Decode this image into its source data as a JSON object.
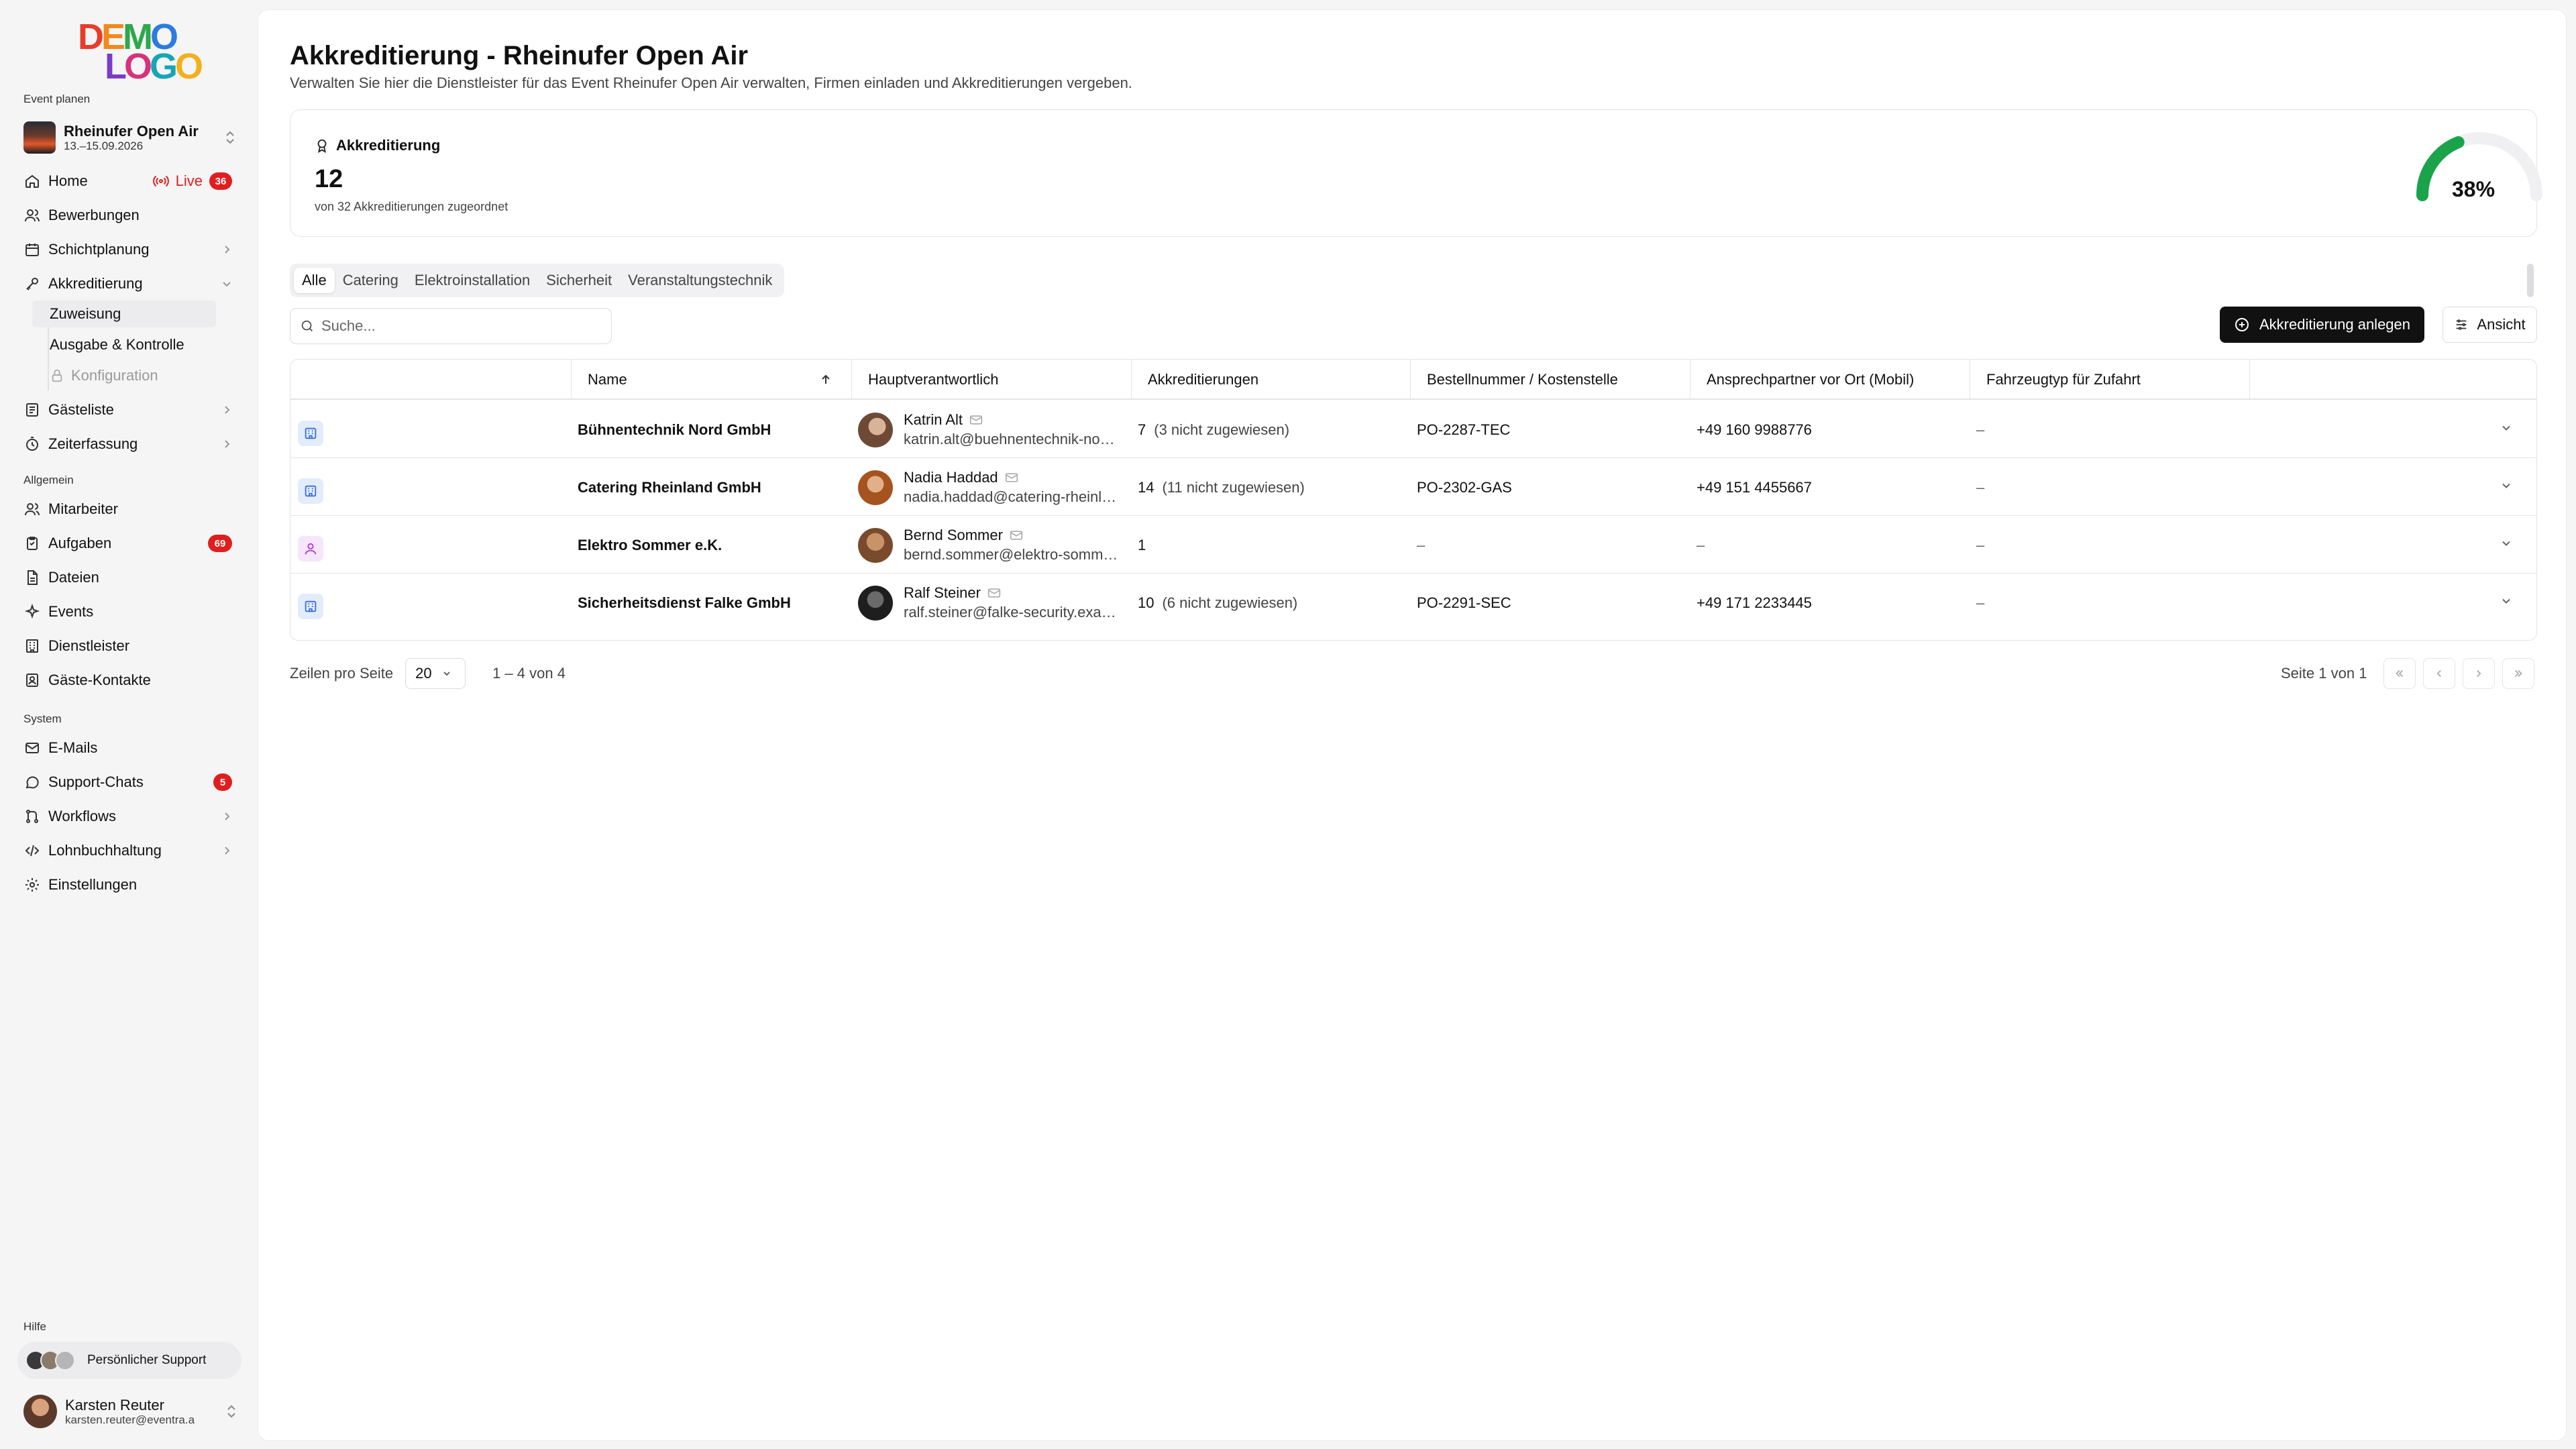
{
  "brand": {
    "logo_line1": "DEMO",
    "logo_line2": "LOGO"
  },
  "sidebar": {
    "event_section_label": "Event planen",
    "event": {
      "name": "Rheinufer Open Air",
      "dates": "13.–15.09.2026"
    },
    "items_main": [
      {
        "label": "Home",
        "icon": "home-icon",
        "live_label": "Live",
        "badge": "36"
      },
      {
        "label": "Bewerbungen",
        "icon": "users-icon"
      },
      {
        "label": "Schichtplanung",
        "icon": "calendar-icon"
      },
      {
        "label": "Akkreditierung",
        "icon": "key-icon",
        "expanded": true
      }
    ],
    "accreditation_sub": [
      {
        "label": "Zuweisung",
        "active": true
      },
      {
        "label": "Ausgabe & Kontrolle"
      },
      {
        "label": "Konfiguration",
        "disabled": true,
        "icon": "lock-icon"
      }
    ],
    "items_after": [
      {
        "label": "Gästeliste",
        "icon": "list-icon"
      },
      {
        "label": "Zeiterfassung",
        "icon": "timer-icon"
      }
    ],
    "general_section_label": "Allgemein",
    "items_general": [
      {
        "label": "Mitarbeiter",
        "icon": "users-icon"
      },
      {
        "label": "Aufgaben",
        "icon": "clipboard-icon",
        "badge": "69"
      },
      {
        "label": "Dateien",
        "icon": "file-icon"
      },
      {
        "label": "Events",
        "icon": "sparkle-icon"
      },
      {
        "label": "Dienstleister",
        "icon": "building-icon"
      },
      {
        "label": "Gäste-Kontakte",
        "icon": "contacts-icon"
      }
    ],
    "system_section_label": "System",
    "items_system": [
      {
        "label": "E-Mails",
        "icon": "mail-icon"
      },
      {
        "label": "Support-Chats",
        "icon": "chat-icon",
        "badge": "5"
      },
      {
        "label": "Workflows",
        "icon": "workflow-icon"
      },
      {
        "label": "Lohnbuchhaltung",
        "icon": "code-icon"
      },
      {
        "label": "Einstellungen",
        "icon": "gear-icon"
      }
    ],
    "help_section_label": "Hilfe",
    "support_label": "Persönlicher Support",
    "user": {
      "name": "Karsten Reuter",
      "email": "karsten.reuter@eventra.a"
    }
  },
  "page": {
    "title": "Akkreditierung - Rheinufer Open Air",
    "subtitle": "Verwalten Sie hier die Dienstleister für das Event Rheinufer Open Air verwalten, Firmen einladen und Akkreditierungen vergeben."
  },
  "stat": {
    "label": "Akkreditierung",
    "value": "12",
    "description": "von 32 Akkreditierungen zugeordnet",
    "percent_label": "38%",
    "percent": 0.38,
    "gauge_color": "#1aa34a"
  },
  "tabs": [
    "Alle",
    "Catering",
    "Elektroinstallation",
    "Sicherheit",
    "Veranstaltungstechnik"
  ],
  "search": {
    "placeholder": "Suche..."
  },
  "actions": {
    "create_label": "Akkreditierung anlegen",
    "view_label": "Ansicht"
  },
  "table": {
    "columns": [
      "Name",
      "Hauptverantwortlich",
      "Akkreditierungen",
      "Bestellnummer / Kostenstelle",
      "Ansprechpartner vor Ort (Mobil)",
      "Fahrzeugtyp für Zufahrt"
    ],
    "rows": [
      {
        "type": "company",
        "name": "Bühnentechnik Nord GmbH",
        "contact_name": "Katrin Alt",
        "contact_email": "katrin.alt@buehnentechnik-nord.de",
        "accreditations": "7",
        "accreditations_note": "(3 nicht zugewiesen)",
        "order_no": "PO-2287-TEC",
        "mobile": "+49 160 9988776",
        "vehicle": "–"
      },
      {
        "type": "company",
        "name": "Catering Rheinland GmbH",
        "contact_name": "Nadia Haddad",
        "contact_email": "nadia.haddad@catering-rheinland.de",
        "accreditations": "14",
        "accreditations_note": "(11 nicht zugewiesen)",
        "order_no": "PO-2302-GAS",
        "mobile": "+49 151 4455667",
        "vehicle": "–"
      },
      {
        "type": "person",
        "name": "Elektro Sommer e.K.",
        "contact_name": "Bernd Sommer",
        "contact_email": "bernd.sommer@elektro-sommer.de",
        "accreditations": "1",
        "accreditations_note": "",
        "order_no": "–",
        "mobile": "–",
        "vehicle": "–"
      },
      {
        "type": "company",
        "name": "Sicherheitsdienst Falke GmbH",
        "contact_name": "Ralf Steiner",
        "contact_email": "ralf.steiner@falke-security.example",
        "accreditations": "10",
        "accreditations_note": "(6 nicht zugewiesen)",
        "order_no": "PO-2291-SEC",
        "mobile": "+49 171 2233445",
        "vehicle": "–"
      }
    ]
  },
  "pagination": {
    "rows_per_page_label": "Zeilen pro Seite",
    "rows_per_page": "20",
    "range": "1 – 4 von 4",
    "page_label": "Seite 1 von 1"
  }
}
